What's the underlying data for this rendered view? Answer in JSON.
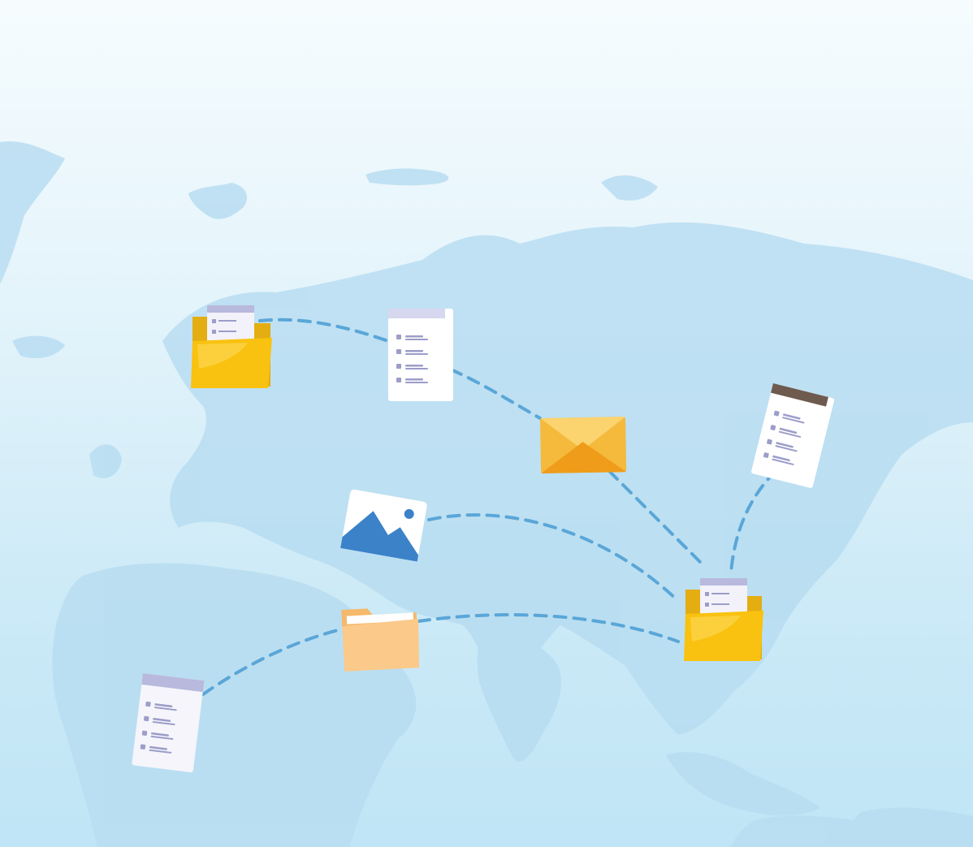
{
  "illustration": {
    "subject": "file-transfer-world-map",
    "icons": [
      "folder-with-document-icon",
      "document-icon",
      "envelope-icon",
      "image-icon",
      "document-icon",
      "folder-icon",
      "document-icon",
      "folder-with-document-icon"
    ],
    "colors": {
      "background_top": "#f6fcfe",
      "background_bottom": "#bfe5f6",
      "land": "#b8ddf1",
      "route": "#5aa6d8",
      "folder_yellow": "#f9c210",
      "folder_back": "#e4ad12",
      "folder_light": "#fbc98a",
      "envelope": "#f5b93c",
      "image_blue": "#3b82c9",
      "doc_header_purple": "#b8b9dd",
      "doc_header_brown": "#6e5a4f"
    }
  }
}
